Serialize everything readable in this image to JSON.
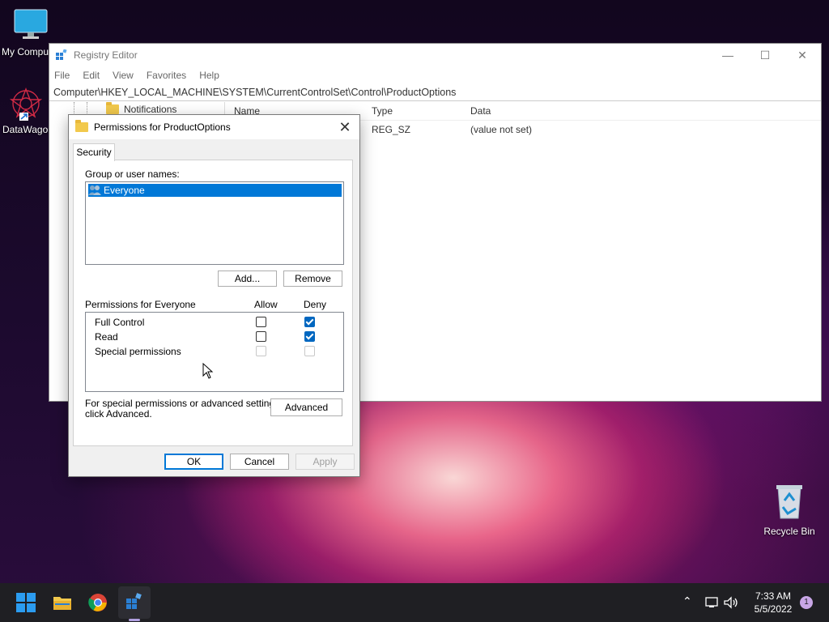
{
  "desktop": {
    "icons": [
      {
        "label": "My Compu"
      },
      {
        "label": "DataWagon"
      },
      {
        "label": "Recycle Bin"
      }
    ]
  },
  "registry": {
    "title": "Registry Editor",
    "menu": [
      "File",
      "Edit",
      "View",
      "Favorites",
      "Help"
    ],
    "address": "Computer\\HKEY_LOCAL_MACHINE\\SYSTEM\\CurrentControlSet\\Control\\ProductOptions",
    "tree_item": "Notifications",
    "columns": {
      "name": "Name",
      "type": "Type",
      "data": "Data"
    },
    "rows": [
      {
        "name": "",
        "type": "REG_SZ",
        "data": "(value not set)"
      }
    ]
  },
  "dialog": {
    "title": "Permissions for ProductOptions",
    "tab": "Security",
    "group_label": "Group or user names:",
    "users": [
      "Everyone"
    ],
    "add_button": "Add...",
    "remove_button": "Remove",
    "perm_label": "Permissions for Everyone",
    "allow_header": "Allow",
    "deny_header": "Deny",
    "permissions": [
      {
        "name": "Full Control",
        "allow": false,
        "deny": true,
        "enabled": true
      },
      {
        "name": "Read",
        "allow": false,
        "deny": true,
        "enabled": true
      },
      {
        "name": "Special permissions",
        "allow": false,
        "deny": false,
        "enabled": false
      }
    ],
    "advanced_text_1": "For special permissions or advanced settings,",
    "advanced_text_2": "click Advanced.",
    "advanced_button": "Advanced",
    "ok_button": "OK",
    "cancel_button": "Cancel",
    "apply_button": "Apply"
  },
  "taskbar": {
    "time": "7:33 AM",
    "date": "5/5/2022",
    "notification_count": "1"
  }
}
